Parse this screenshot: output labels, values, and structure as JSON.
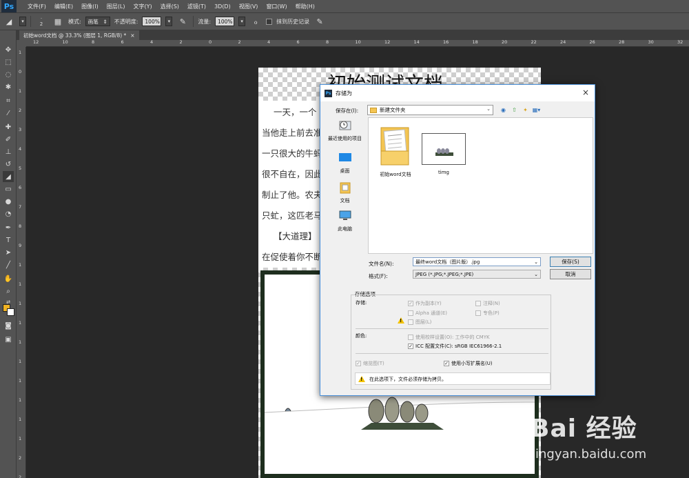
{
  "app": {
    "logo": "Ps"
  },
  "menu": [
    "文件(F)",
    "编辑(E)",
    "图像(I)",
    "图层(L)",
    "文字(Y)",
    "选择(S)",
    "滤镜(T)",
    "3D(D)",
    "视图(V)",
    "窗口(W)",
    "帮助(H)"
  ],
  "options": {
    "brush_size": "2",
    "mode_label": "模式:",
    "mode_value": "画笔",
    "opacity_label": "不透明度:",
    "opacity_value": "100%",
    "flow_label": "流量:",
    "flow_value": "100%",
    "erase_history_label": "抹到历史记录"
  },
  "document_tab": {
    "title": "初始word文档 @ 33.3% (图层 1, RGB/8) *",
    "close": "×"
  },
  "ruler_top": [
    "12",
    "10",
    "8",
    "6",
    "4",
    "2",
    "0",
    "2",
    "4",
    "6",
    "8",
    "10",
    "12",
    "14",
    "16",
    "18",
    "20",
    "22",
    "24",
    "26",
    "28",
    "30",
    "32"
  ],
  "ruler_left": [
    "1",
    "0",
    "1",
    "2",
    "3",
    "4",
    "5",
    "6",
    "7",
    "8",
    "9",
    "1",
    "1",
    "1",
    "1",
    "1",
    "1",
    "1",
    "1",
    "1",
    "1",
    "2",
    "2"
  ],
  "document": {
    "title": "初始测试文档",
    "lines": [
      "一天，一个",
      "当他走上前去准",
      "一只很大的牛蚂",
      "很不自在，因此",
      "制止了他。农夫",
      "只虻，这匹老马",
      "【大道理】",
      "在促使着你不断"
    ]
  },
  "dialog": {
    "title": "存储为",
    "close": "×",
    "save_in_label": "保存在(I):",
    "save_in_value": "新建文件夹",
    "places": [
      "最近使用的项目",
      "桌面",
      "文档",
      "此电脑"
    ],
    "files": [
      "初始word文档",
      "timg"
    ],
    "filename_label": "文件名(N):",
    "filename_value": "最终word文档（图片版）.jpg",
    "format_label": "格式(F):",
    "format_value": "JPEG (*.JPG;*.JPEG;*.JPE)",
    "save_button": "保存(S)",
    "cancel_button": "取消",
    "options_title": "存储选项",
    "store_label": "存储:",
    "as_copy": "作为副本(Y)",
    "notes": "注释(N)",
    "alpha": "Alpha 通道(E)",
    "spot": "专色(P)",
    "layers": "图层(L)",
    "color_label": "颜色:",
    "use_proof": "使用校样设置(O): 工作中的 CMYK",
    "icc_profile": "ICC 配置文件(C): sRGB IEC61966-2.1",
    "thumbnail": "缩览图(T)",
    "lowercase_ext": "使用小写扩展名(U)",
    "warning": "在此选项下，文件必须存储为拷贝。"
  },
  "watermark": {
    "main": "Bai 经验",
    "sub": "jingyan.baidu.com"
  }
}
